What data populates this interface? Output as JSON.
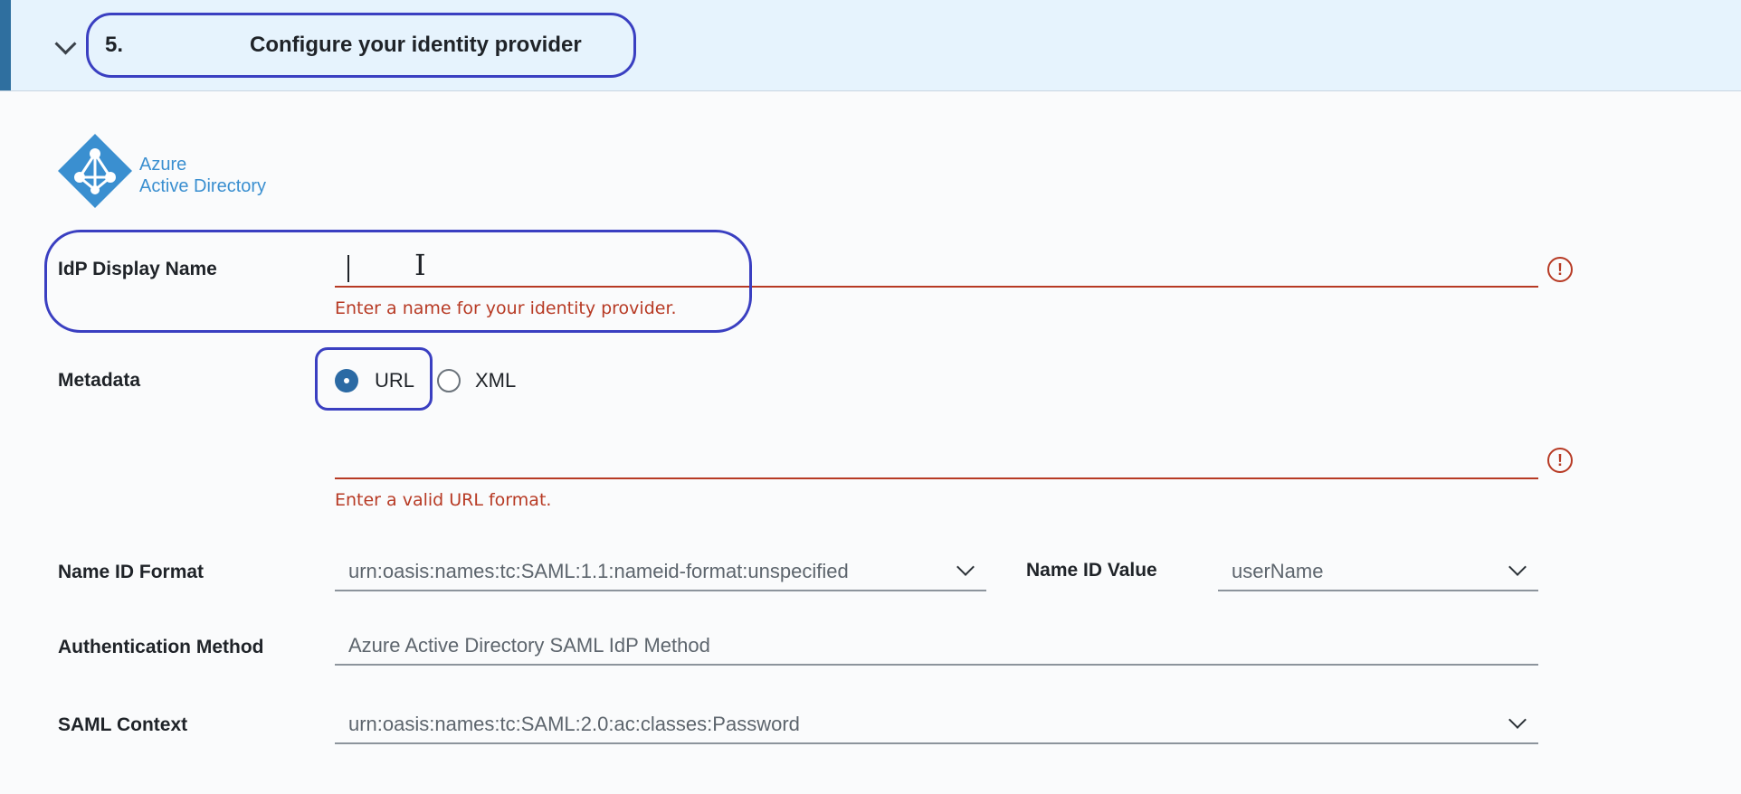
{
  "step": {
    "number": "5.",
    "title": "Configure your identity provider"
  },
  "logo": {
    "line1": "Azure",
    "line2": "Active Directory"
  },
  "form": {
    "idp_display_name": {
      "label": "IdP Display Name",
      "value": "",
      "error": "Enter a name for your identity provider."
    },
    "metadata": {
      "label": "Metadata",
      "options": [
        "URL",
        "XML"
      ],
      "selected": "URL",
      "url_value": "",
      "error": "Enter a valid URL format."
    },
    "name_id_format": {
      "label": "Name ID Format",
      "value": "urn:oasis:names:tc:SAML:1.1:nameid-format:unspecified"
    },
    "name_id_value": {
      "label": "Name ID Value",
      "value": "userName"
    },
    "authentication_method": {
      "label": "Authentication Method",
      "value": "Azure Active Directory SAML IdP Method"
    },
    "saml_context": {
      "label": "SAML Context",
      "value": "urn:oasis:names:tc:SAML:2.0:ac:classes:Password"
    }
  },
  "colors": {
    "header_bg": "#e6f3fd",
    "accent": "#2f6f9f",
    "error": "#b73a24",
    "annotation": "#3a3fc1",
    "radio_selected": "#2b6aa4"
  },
  "icons": [
    "chevron-down-icon",
    "azure-active-directory-logo",
    "error-icon",
    "text-cursor-icon"
  ]
}
